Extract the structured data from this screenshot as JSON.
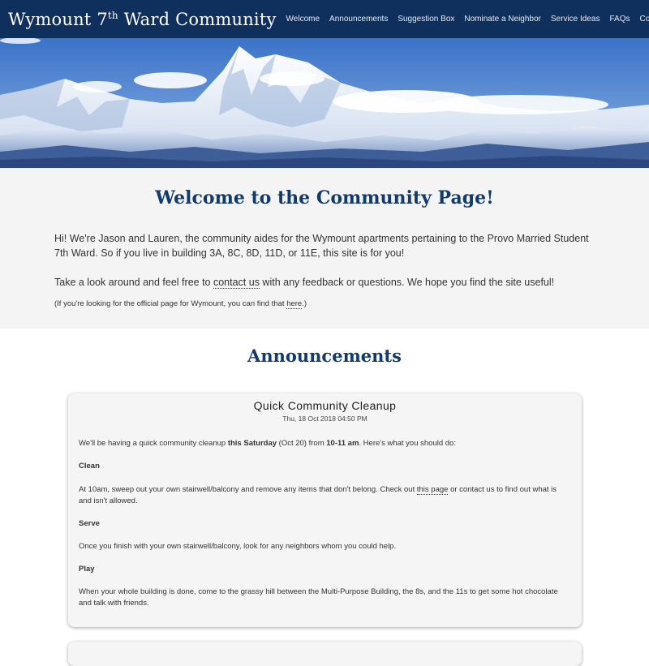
{
  "header": {
    "title_main": "Wymount 7",
    "title_sup": "th",
    "title_rest": " Ward Community",
    "nav": [
      "Welcome",
      "Announcements",
      "Suggestion Box",
      "Nominate a Neighbor",
      "Service Ideas",
      "FAQs",
      "Contact Us"
    ]
  },
  "welcome": {
    "heading": "Welcome to the Community Page!",
    "intro": "Hi! We're Jason and Lauren, the community aides for the Wymount apartments pertaining to the Provo Married Student 7th Ward. So if you live in building 3A, 8C, 8D, 11D, or 11E, this site is for you!",
    "feedback_before": "Take a look around and feel free to ",
    "feedback_link": "contact us",
    "feedback_after": " with any feedback or questions. We hope you find the site useful!",
    "official_before": "(If you're looking for the official page for Wymount, you can find that ",
    "official_link": "here",
    "official_after": ".)"
  },
  "announcements": {
    "heading": "Announcements",
    "posts": [
      {
        "title": "Quick Community Cleanup",
        "date": "Thu, 18 Oct 2018 04:50 PM",
        "intro_1": "We'll be having a quick community cleanup ",
        "intro_bold_1": "this Saturday",
        "intro_2": " (Oct 20) from ",
        "intro_bold_2": "10-11 am",
        "intro_3": ". Here's what you should do:",
        "clean_heading": "Clean",
        "clean_text_1": "At 10am, sweep out your own stairwell/balcony and remove any items that don't belong. Check out ",
        "clean_link": "this page",
        "clean_text_2": " or contact us to find out what is and isn't allowed.",
        "serve_heading": "Serve",
        "serve_text": "Once you finish with your own stairwell/balcony, look for any neighbors whom you could help.",
        "play_heading": "Play",
        "play_text": "When your whole building is done, come to the grassy hill between the Multi-Purpose Building, the 8s, and the 11s to get some hot chocolate and talk with friends."
      }
    ]
  },
  "colors": {
    "header_bg": "#0f2f5c",
    "heading": "#123a6b",
    "section_bg": "#f4f4f4"
  }
}
